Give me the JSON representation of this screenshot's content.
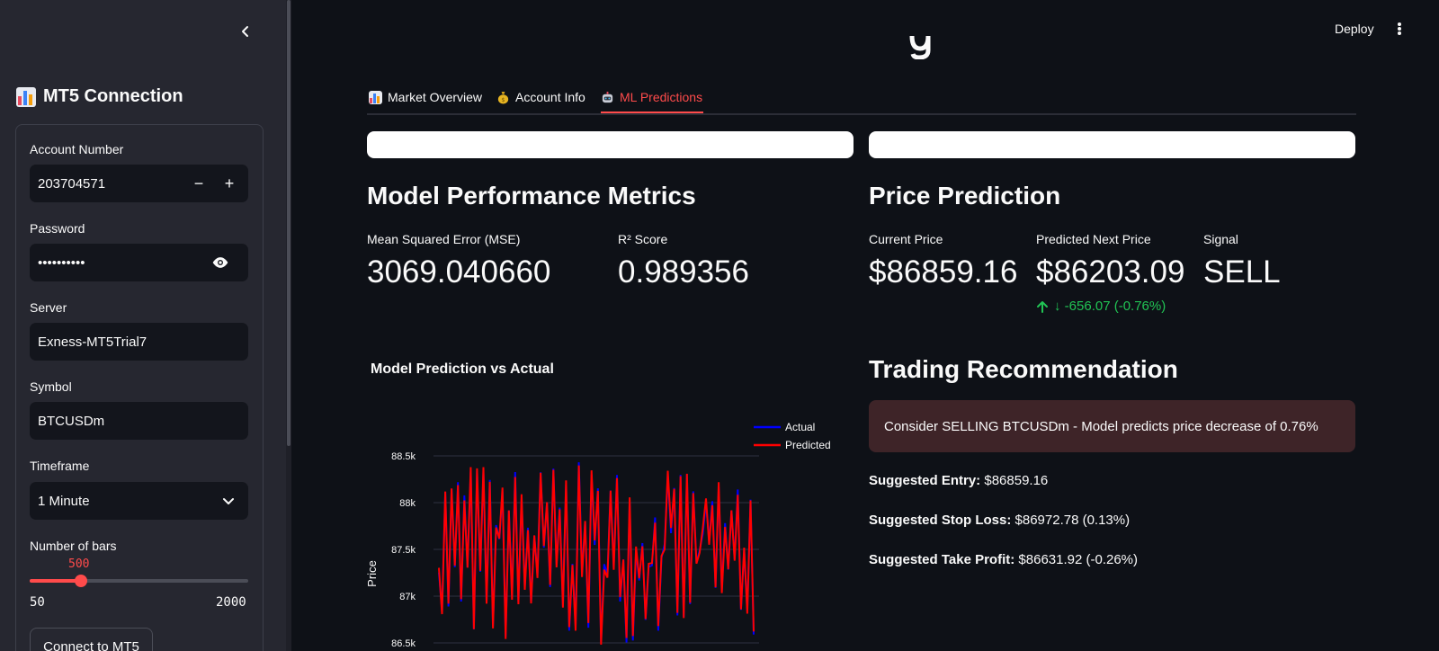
{
  "sidebar": {
    "header": "MT5 Connection",
    "fields": {
      "account_label": "Account Number",
      "account_value": "203704571",
      "password_label": "Password",
      "password_value": "••••••••••",
      "server_label": "Server",
      "server_value": "Exness-MT5Trial7",
      "symbol_label": "Symbol",
      "symbol_value": "BTCUSDm",
      "timeframe_label": "Timeframe",
      "timeframe_value": "1 Minute",
      "bars_label": "Number of bars",
      "bars_value": "500",
      "bars_min": "50",
      "bars_max": "2000",
      "bars_fraction": 0.2353
    },
    "stepper_minus": "−",
    "stepper_plus": "+",
    "connect_button": "Connect to MT5"
  },
  "topbar": {
    "deploy": "Deploy"
  },
  "tabs": [
    {
      "label": "Market Overview",
      "icon": "bar-chart-icon"
    },
    {
      "label": "Account Info",
      "icon": "money-bag-icon"
    },
    {
      "label": "ML Predictions",
      "icon": "robot-icon",
      "active": true
    }
  ],
  "metrics": {
    "title": "Model Performance Metrics",
    "mse_label": "Mean Squared Error (MSE)",
    "mse_value": "3069.040660",
    "r2_label": "R² Score",
    "r2_value": "0.989356"
  },
  "prediction": {
    "title": "Price Prediction",
    "current_label": "Current Price",
    "current_value": "$86859.16",
    "predicted_label": "Predicted Next Price",
    "predicted_value": "$86203.09",
    "delta": "↓ -656.07 (-0.76%)",
    "signal_label": "Signal",
    "signal_value": "SELL"
  },
  "recommendation": {
    "title": "Trading Recommendation",
    "alert": "Consider SELLING BTCUSDm - Model predicts price decrease of 0.76%",
    "entry_label": "Suggested Entry:",
    "entry_value": "$86859.16",
    "stop_label": "Suggested Stop Loss:",
    "stop_value": "$86972.78 (0.13%)",
    "tp_label": "Suggested Take Profit:",
    "tp_value": "$86631.92 (-0.26%)"
  },
  "colors": {
    "accent": "#ff4b4b",
    "positive": "#21c354",
    "actual_series": "#0000ff",
    "predicted_series": "#ff0000",
    "alert_bg": "#3e2428"
  },
  "chart_data": {
    "type": "line",
    "title": "Model Prediction vs Actual",
    "ylabel": "Price",
    "xlabel": "",
    "ylim": [
      86500,
      88700
    ],
    "yticks": [
      86500,
      87000,
      87500,
      88000,
      88500
    ],
    "ytick_labels": [
      "86.5k",
      "87k",
      "87.5k",
      "88k",
      "88.5k"
    ],
    "legend_position": "top-right",
    "grid": true,
    "series": [
      {
        "name": "Actual",
        "color": "#0000ff"
      },
      {
        "name": "Predicted",
        "color": "#ff0000"
      }
    ],
    "point_count": 100,
    "value_range": [
      86500,
      88650
    ]
  }
}
